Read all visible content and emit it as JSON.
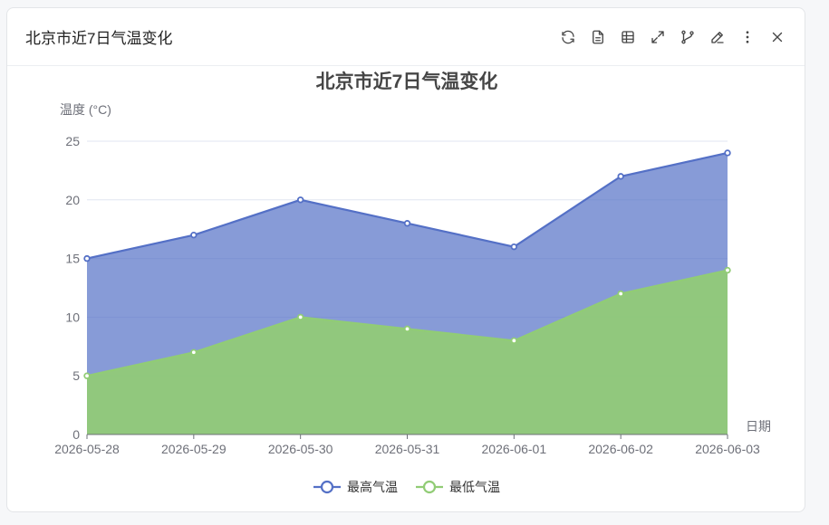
{
  "header": {
    "title": "北京市近7日气温变化"
  },
  "toolbar": {
    "icons": [
      "refresh-icon",
      "document-icon",
      "table-icon",
      "expand-icon",
      "branch-icon",
      "edit-icon",
      "more-icon",
      "close-icon"
    ]
  },
  "colors": {
    "high": "#5470c6",
    "low": "#91cc75",
    "axis": "#6e7079",
    "grid": "#e0e6f1"
  },
  "chart_data": {
    "type": "area",
    "title": "北京市近7日气温变化",
    "ylabel": "温度 (°C)",
    "xlabel": "日期",
    "categories": [
      "2026-05-28",
      "2026-05-29",
      "2026-05-30",
      "2026-05-31",
      "2026-06-01",
      "2026-06-02",
      "2026-06-03"
    ],
    "ylim": [
      0,
      25
    ],
    "yticks": [
      0,
      5,
      10,
      15,
      20,
      25
    ],
    "grid": true,
    "legend_position": "bottom",
    "series": [
      {
        "name": "最高气温",
        "values": [
          15,
          17,
          20,
          18,
          16,
          22,
          24
        ]
      },
      {
        "name": "最低气温",
        "values": [
          5,
          7,
          10,
          9,
          8,
          12,
          14
        ]
      }
    ]
  }
}
